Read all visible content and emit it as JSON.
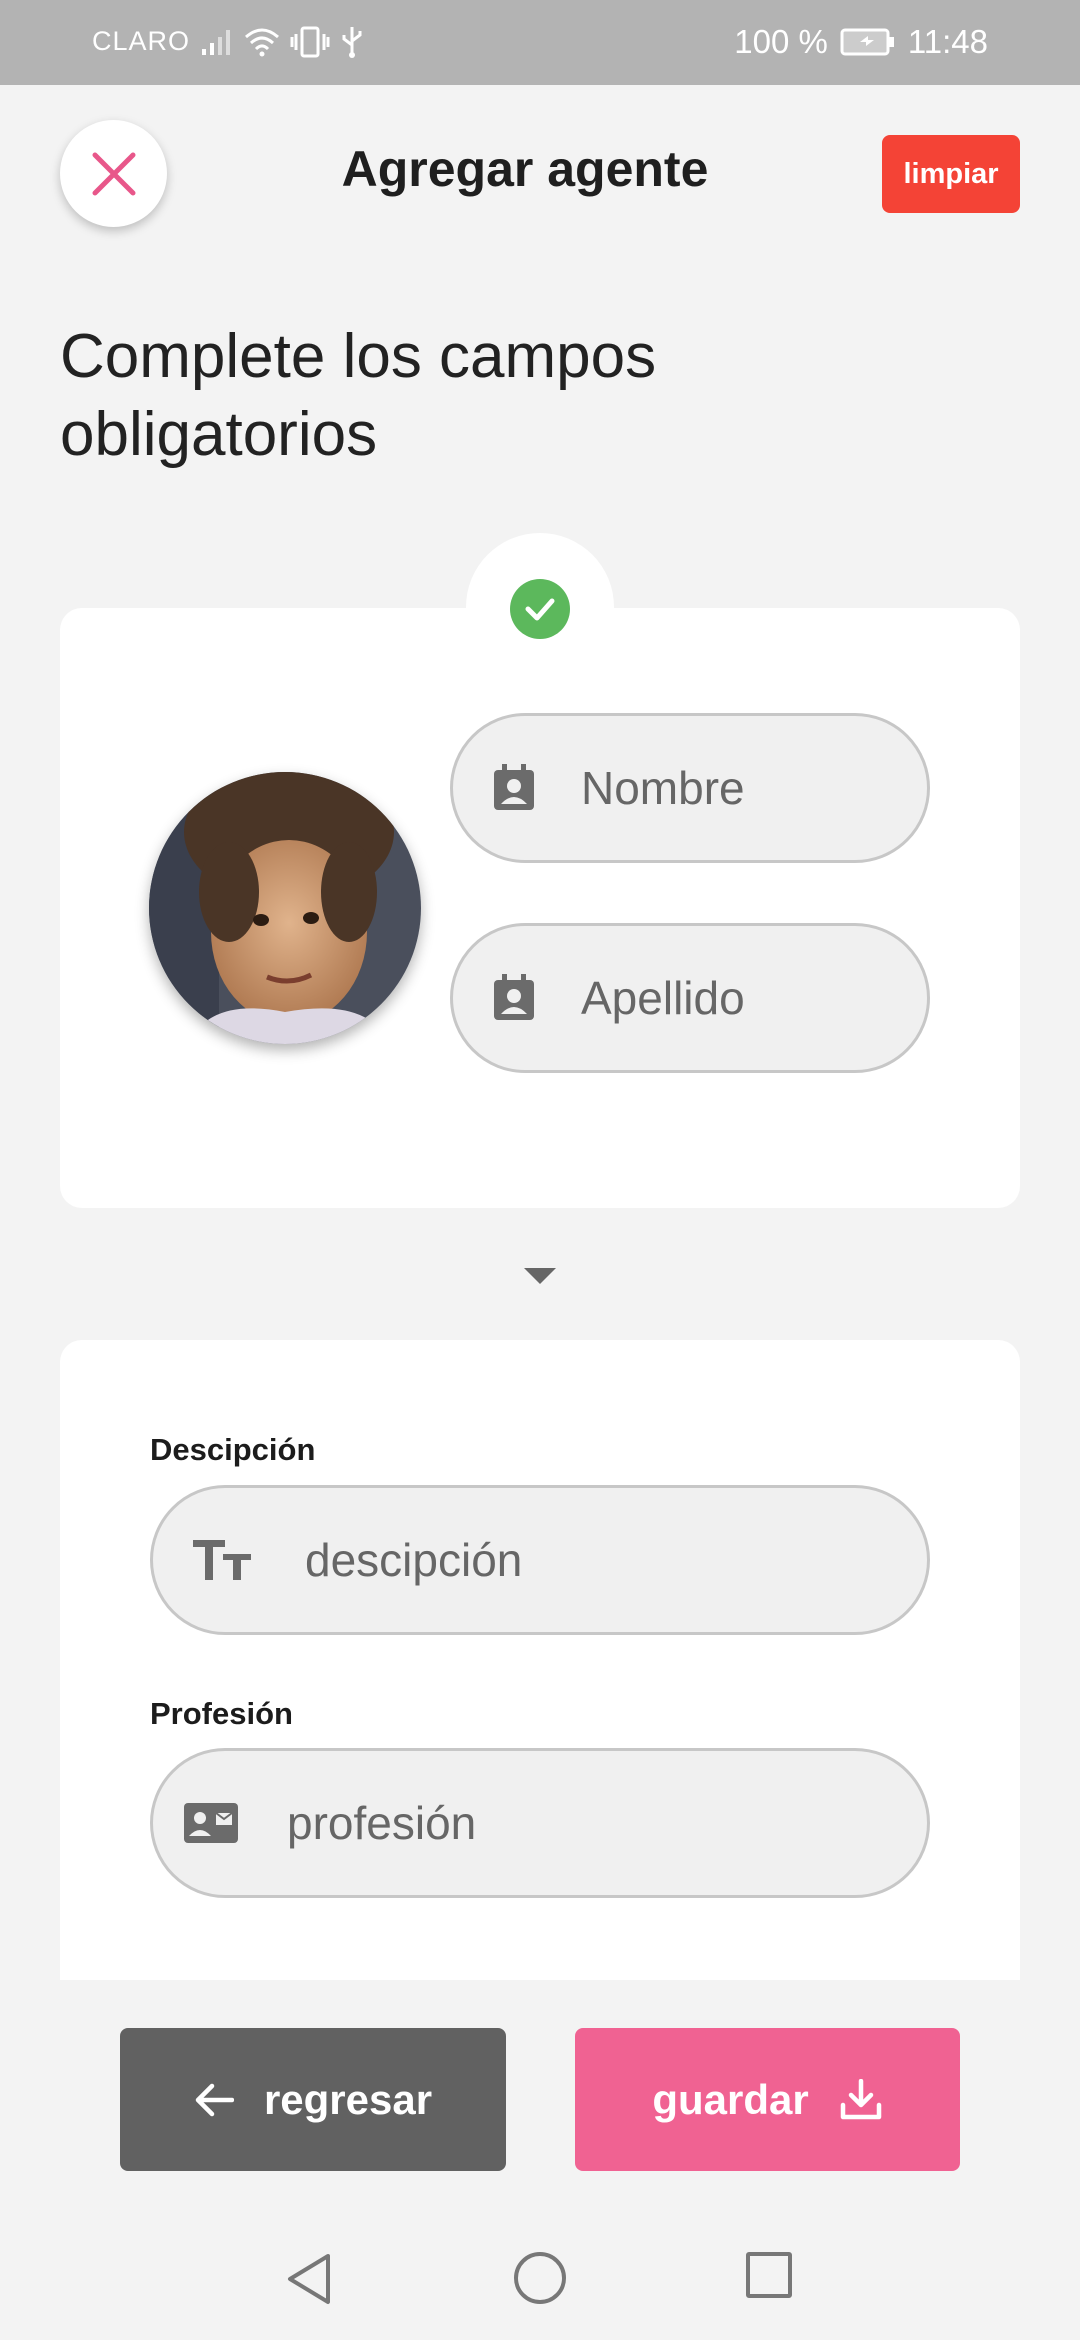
{
  "status_bar": {
    "carrier": "CLARO",
    "battery": "100 %",
    "time": "11:48"
  },
  "header": {
    "title": "Agregar agente",
    "clear_label": "limpiar"
  },
  "subtitle": "Complete los campos obligatorios",
  "profile": {
    "first_name_placeholder": "Nombre",
    "last_name_placeholder": "Apellido"
  },
  "details": {
    "description_label": "Descipción",
    "description_placeholder": "descipción",
    "profession_label": "Profesión",
    "profession_placeholder": "profesión"
  },
  "actions": {
    "back_label": "regresar",
    "save_label": "guardar"
  },
  "colors": {
    "accent_pink": "#f06292",
    "danger_red": "#f44336",
    "success_green": "#5cb85c",
    "dark_gray": "#616161"
  }
}
